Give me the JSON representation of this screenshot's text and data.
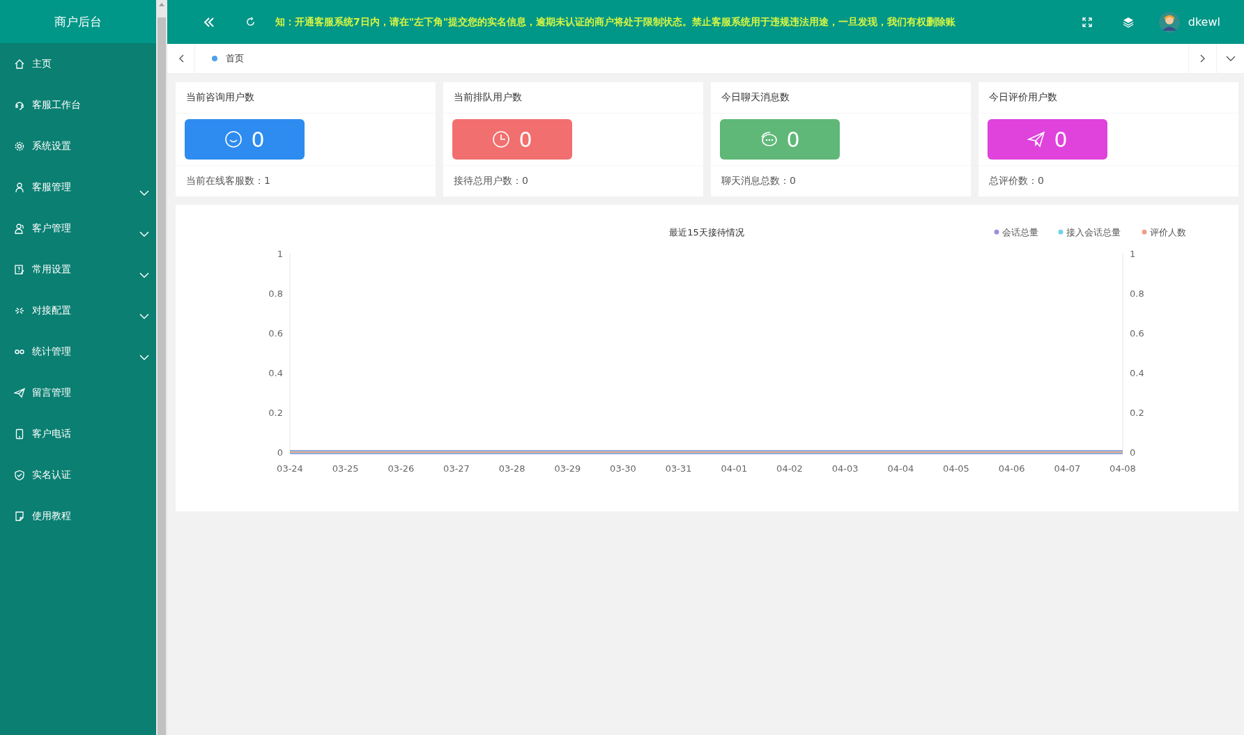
{
  "sidebar": {
    "title": "商户后台",
    "items": [
      {
        "label": "主页",
        "submenu": false
      },
      {
        "label": "客服工作台",
        "submenu": false
      },
      {
        "label": "系统设置",
        "submenu": false
      },
      {
        "label": "客服管理",
        "submenu": true
      },
      {
        "label": "客户管理",
        "submenu": true
      },
      {
        "label": "常用设置",
        "submenu": true
      },
      {
        "label": "对接配置",
        "submenu": true
      },
      {
        "label": "统计管理",
        "submenu": true
      },
      {
        "label": "留言管理",
        "submenu": false
      },
      {
        "label": "客户电话",
        "submenu": false
      },
      {
        "label": "实名认证",
        "submenu": false
      },
      {
        "label": "使用教程",
        "submenu": false
      }
    ]
  },
  "header": {
    "notice": "知：开通客服系统7日内，请在\"左下角\"提交您的实名信息，逾期未认证的商户将处于限制状态。禁止客服系统用于违规违法用途，一旦发现，我们有权删除账",
    "username": "dkewl"
  },
  "tabs": [
    {
      "label": "首页",
      "selected": true
    }
  ],
  "cards": [
    {
      "title": "当前咨询用户数",
      "value": "0",
      "footer": "当前在线客服数：1",
      "color": "#2e8cf0"
    },
    {
      "title": "当前排队用户数",
      "value": "0",
      "footer": "接待总用户数：0",
      "color": "#f26f6f"
    },
    {
      "title": "今日聊天消息数",
      "value": "0",
      "footer": "聊天消息总数：0",
      "color": "#5fb878"
    },
    {
      "title": "今日评价用户数",
      "value": "0",
      "footer": "总评价数：0",
      "color": "#e042dc"
    }
  ],
  "chart_panel": {
    "chart_data": {
      "type": "line",
      "title": "最近15天接待情况",
      "categories": [
        "03-24",
        "03-25",
        "03-26",
        "03-27",
        "03-28",
        "03-29",
        "03-30",
        "03-31",
        "04-01",
        "04-02",
        "04-03",
        "04-04",
        "04-05",
        "04-06",
        "04-07",
        "04-08"
      ],
      "series": [
        {
          "name": "会话总量",
          "color": "#9d8ee0",
          "values": [
            0,
            0,
            0,
            0,
            0,
            0,
            0,
            0,
            0,
            0,
            0,
            0,
            0,
            0,
            0,
            0
          ]
        },
        {
          "name": "接入会话总量",
          "color": "#6fd3e6",
          "values": [
            0,
            0,
            0,
            0,
            0,
            0,
            0,
            0,
            0,
            0,
            0,
            0,
            0,
            0,
            0,
            0
          ]
        },
        {
          "name": "评价人数",
          "color": "#f29c86",
          "values": [
            0,
            0,
            0,
            0,
            0,
            0,
            0,
            0,
            0,
            0,
            0,
            0,
            0,
            0,
            0,
            0
          ]
        }
      ],
      "ylim": [
        0,
        1
      ],
      "yticks": [
        0,
        0.2,
        0.4,
        0.6,
        0.8,
        1
      ],
      "y2ticks": [
        0,
        0.2,
        0.4,
        0.6,
        0.8,
        1
      ],
      "y2lim": [
        0,
        1
      ],
      "legend": true
    }
  }
}
